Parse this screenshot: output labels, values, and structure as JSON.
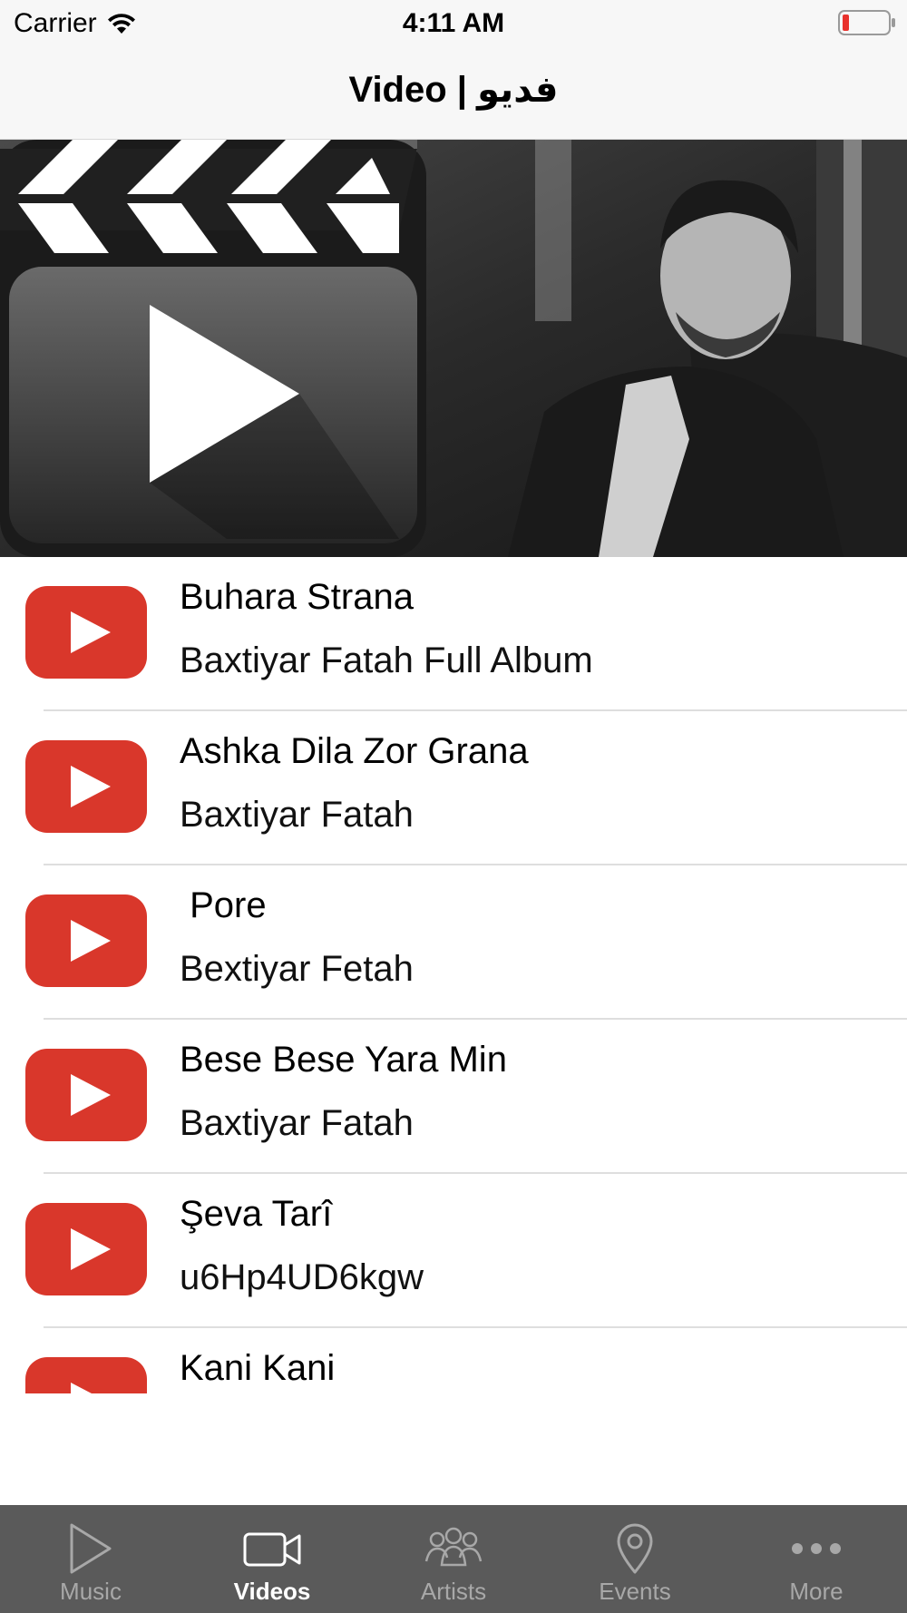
{
  "status": {
    "carrier": "Carrier",
    "time": "4:11 AM"
  },
  "nav": {
    "title": "Video | فديو"
  },
  "videos": [
    {
      "title": "Buhara Strana",
      "subtitle": "Baxtiyar Fatah Full Album"
    },
    {
      "title": "Ashka Dila Zor Grana",
      "subtitle": "Baxtiyar Fatah"
    },
    {
      "title": " Pore",
      "subtitle": "Bextiyar Fetah"
    },
    {
      "title": "Bese Bese Yara Min",
      "subtitle": "Baxtiyar Fatah"
    },
    {
      "title": "Şeva Tarî",
      "subtitle": "u6Hp4UD6kgw"
    },
    {
      "title": "Kani Kani",
      "subtitle": ""
    }
  ],
  "tabs": [
    {
      "label": "Music",
      "icon": "play-outline-icon"
    },
    {
      "label": "Videos",
      "icon": "video-camera-icon"
    },
    {
      "label": "Artists",
      "icon": "people-group-icon"
    },
    {
      "label": "Events",
      "icon": "map-pin-icon"
    },
    {
      "label": "More",
      "icon": "more-dots-icon"
    }
  ],
  "colors": {
    "youtube_red": "#d9372b",
    "tabbar_bg": "#5a5a5a",
    "battery_low": "#e8322d"
  }
}
